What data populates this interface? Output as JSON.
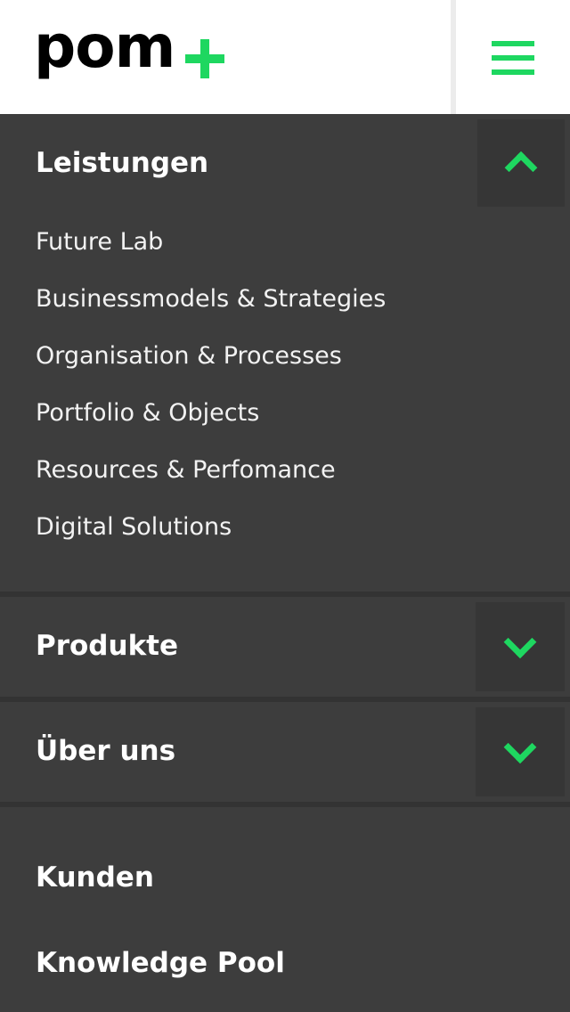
{
  "header": {
    "logo_text": "pom",
    "menu_icon": "hamburger-menu-icon"
  },
  "menu": {
    "leistungen": {
      "title": "Leistungen",
      "expanded": true,
      "toggle_icon": "chevron-up-icon",
      "items": [
        "Future Lab",
        "Businessmodels & Strategies",
        "Organisation & Processes",
        "Portfolio & Objects",
        "Resources & Perfomance",
        "Digital Solutions"
      ]
    },
    "produkte": {
      "title": "Produkte",
      "expanded": false,
      "toggle_icon": "chevron-down-icon"
    },
    "ueber_uns": {
      "title": "Über uns",
      "expanded": false,
      "toggle_icon": "chevron-down-icon"
    },
    "kunden": {
      "title": "Kunden"
    },
    "knowledge_pool": {
      "title": "Knowledge Pool"
    }
  },
  "colors": {
    "accent": "#1ed760",
    "menu_background": "#3d3d3d",
    "toggle_background": "#363636",
    "header_background": "#ffffff"
  }
}
